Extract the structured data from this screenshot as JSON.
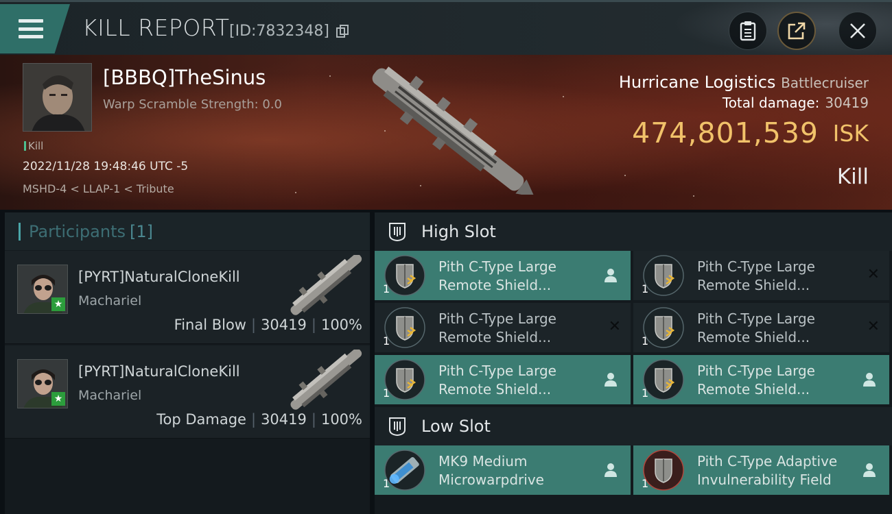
{
  "header": {
    "title": "KILL REPORT",
    "report_id": "[ID:7832348]",
    "buttons": [
      "clipboard-icon",
      "share-icon",
      "close-icon"
    ]
  },
  "victim": {
    "name": "[BBBQ]TheSinus",
    "warp_scramble": "Warp Scramble Strength: 0.0",
    "tag": "Kill",
    "datetime": "2022/11/28 19:48:46 UTC -5",
    "location": "MSHD-4 < LLAP-1 < Tribute",
    "ship": "Hurricane Logistics",
    "ship_class": "Battlecruiser",
    "total_damage_label": "Total damage:",
    "total_damage": "30419",
    "isk_value": "474,801,539",
    "isk_unit": "ISK",
    "result": "Kill"
  },
  "participants": {
    "title": "Participants",
    "count": "[1]",
    "rows": [
      {
        "name": "[PYRT]NaturalCloneKill",
        "ship": "Machariel",
        "role": "Final Blow",
        "damage": "30419",
        "percent": "100%"
      },
      {
        "name": "[PYRT]NaturalCloneKill",
        "ship": "Machariel",
        "role": "Top Damage",
        "damage": "30419",
        "percent": "100%"
      }
    ],
    "separator": "|"
  },
  "slots": {
    "high": {
      "title": "High Slot",
      "modules": [
        {
          "line1": "Pith C-Type Large",
          "line2": "Remote Shield...",
          "qty": "1",
          "state": "online"
        },
        {
          "line1": "Pith C-Type Large",
          "line2": "Remote Shield...",
          "qty": "1",
          "state": "destroyed"
        },
        {
          "line1": "Pith C-Type Large",
          "line2": "Remote Shield...",
          "qty": "1",
          "state": "destroyed"
        },
        {
          "line1": "Pith C-Type Large",
          "line2": "Remote Shield...",
          "qty": "1",
          "state": "destroyed"
        },
        {
          "line1": "Pith C-Type Large",
          "line2": "Remote Shield...",
          "qty": "1",
          "state": "online"
        },
        {
          "line1": "Pith C-Type Large",
          "line2": "Remote Shield...",
          "qty": "1",
          "state": "online"
        }
      ]
    },
    "low": {
      "title": "Low Slot",
      "modules": [
        {
          "line1": "MK9 Medium",
          "line2": "Microwarpdrive",
          "qty": "1",
          "state": "online"
        },
        {
          "line1": "Pith C-Type Adaptive",
          "line2": "Invulnerability Field",
          "qty": "1",
          "state": "online"
        }
      ]
    }
  }
}
